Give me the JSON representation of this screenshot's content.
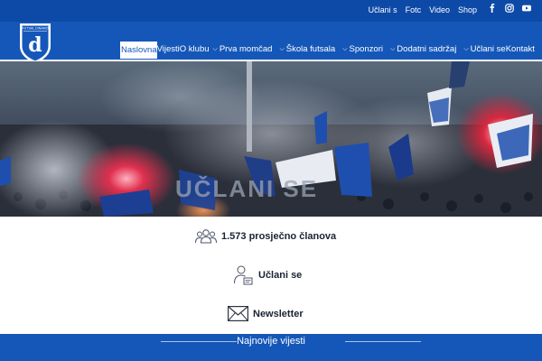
{
  "topbar": {
    "links": [
      "Učlani s",
      "Fotc",
      "Video",
      "Shop"
    ],
    "social": [
      "facebook-icon",
      "instagram-icon",
      "youtube-icon"
    ]
  },
  "header": {
    "logo_icon": "club-crest-logo",
    "nav": [
      {
        "label": "Naslovna",
        "dropdown": false,
        "active": true
      },
      {
        "label": "Vijesti",
        "dropdown": false,
        "active": false
      },
      {
        "label": "O klubu",
        "dropdown": true,
        "active": false
      },
      {
        "label": "Prva momčad",
        "dropdown": true,
        "active": false
      },
      {
        "label": "Škola futsala",
        "dropdown": true,
        "active": false
      },
      {
        "label": "Sponzori",
        "dropdown": true,
        "active": false
      },
      {
        "label": "Dodatni sadržaj",
        "dropdown": true,
        "active": false
      },
      {
        "label": "Učlani se",
        "dropdown": true,
        "active": false
      },
      {
        "label": "Kontakt",
        "dropdown": false,
        "active": false
      }
    ]
  },
  "hero": {
    "image": "supporters-banner-photo"
  },
  "stats": {
    "members": {
      "icon": "group-icon",
      "label": "1.573 prosječno članova"
    },
    "join": {
      "icon": "user-join-icon",
      "label": "Učlani se"
    },
    "newsletter": {
      "icon": "envelope-icon",
      "label": "Newsletter"
    }
  },
  "news_section": {
    "title": "Najnovije vijesti"
  },
  "colors": {
    "brand_blue": "#1557b8",
    "top_blue": "#0d4aa8",
    "text_dark": "#1a2233"
  }
}
